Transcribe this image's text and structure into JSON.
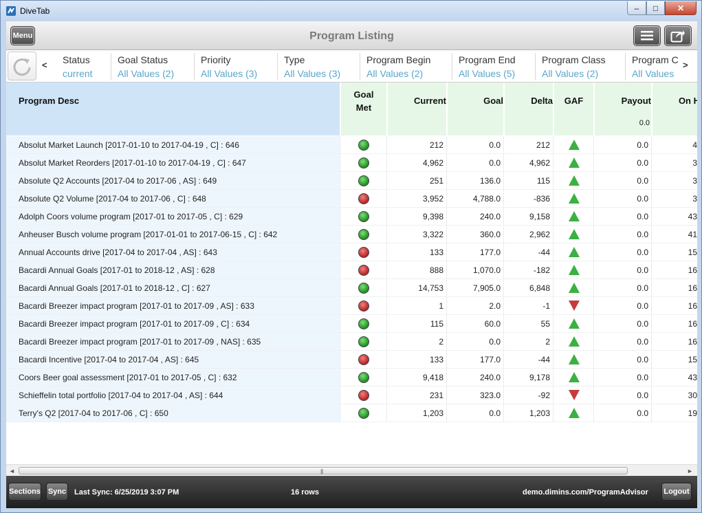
{
  "window": {
    "title": "DiveTab",
    "min": "–",
    "max": "□",
    "close": "✕"
  },
  "header": {
    "menu_label": "Menu",
    "page_title": "Program Listing"
  },
  "filters": [
    {
      "label": "Status",
      "value": "current"
    },
    {
      "label": "Goal Status",
      "value": "All Values (2)"
    },
    {
      "label": "Priority",
      "value": "All Values (3)"
    },
    {
      "label": "Type",
      "value": "All Values (3)"
    },
    {
      "label": "Program Begin",
      "value": "All Values (2)"
    },
    {
      "label": "Program End",
      "value": "All Values (5)"
    },
    {
      "label": "Program Class",
      "value": "All Values (2)"
    },
    {
      "label": "Program C",
      "value": "All Values"
    }
  ],
  "nav": {
    "left": "<",
    "right": ">"
  },
  "columns": {
    "desc": "Program Desc",
    "goal_met_1": "Goal",
    "goal_met_2": "Met",
    "current": "Current",
    "goal": "Goal",
    "delta": "Delta",
    "gaf": "GAF",
    "payout": "Payout",
    "payout_total": "0.0",
    "on_hand": "On H"
  },
  "status_colors": {
    "green": "#2a9a2a",
    "red": "#c03030",
    "up": "#3cb043",
    "down": "#c53c3c"
  },
  "rows": [
    {
      "desc": "Absolut Market Launch [2017-01-10 to 2017-04-19 , C] : 646",
      "met": "green",
      "current": "212",
      "goal": "0.0",
      "delta": "212",
      "gaf": "up",
      "payout": "0.0",
      "onh": "4"
    },
    {
      "desc": "Absolut Market Reorders [2017-01-10 to 2017-04-19 , C] : 647",
      "met": "green",
      "current": "4,962",
      "goal": "0.0",
      "delta": "4,962",
      "gaf": "up",
      "payout": "0.0",
      "onh": "3"
    },
    {
      "desc": "Absolute Q2 Accounts [2017-04 to 2017-06 , AS] : 649",
      "met": "green",
      "current": "251",
      "goal": "136.0",
      "delta": "115",
      "gaf": "up",
      "payout": "0.0",
      "onh": "3"
    },
    {
      "desc": "Absolute Q2 Volume [2017-04 to 2017-06 , C] : 648",
      "met": "red",
      "current": "3,952",
      "goal": "4,788.0",
      "delta": "-836",
      "gaf": "up",
      "payout": "0.0",
      "onh": "3"
    },
    {
      "desc": "Adolph Coors volume program [2017-01 to 2017-05 , C] : 629",
      "met": "green",
      "current": "9,398",
      "goal": "240.0",
      "delta": "9,158",
      "gaf": "up",
      "payout": "0.0",
      "onh": "43"
    },
    {
      "desc": "Anheuser Busch volume program [2017-01-01 to 2017-06-15 , C] : 642",
      "met": "green",
      "current": "3,322",
      "goal": "360.0",
      "delta": "2,962",
      "gaf": "up",
      "payout": "0.0",
      "onh": "41"
    },
    {
      "desc": "Annual Accounts drive [2017-04 to 2017-04 , AS] : 643",
      "met": "red",
      "current": "133",
      "goal": "177.0",
      "delta": "-44",
      "gaf": "up",
      "payout": "0.0",
      "onh": "15"
    },
    {
      "desc": "Bacardi Annual Goals [2017-01 to 2018-12 , AS] : 628",
      "met": "red",
      "current": "888",
      "goal": "1,070.0",
      "delta": "-182",
      "gaf": "up",
      "payout": "0.0",
      "onh": "16"
    },
    {
      "desc": "Bacardi Annual Goals [2017-01 to 2018-12 , C] : 627",
      "met": "green",
      "current": "14,753",
      "goal": "7,905.0",
      "delta": "6,848",
      "gaf": "up",
      "payout": "0.0",
      "onh": "16"
    },
    {
      "desc": "Bacardi Breezer impact program [2017-01 to 2017-09 , AS] : 633",
      "met": "red",
      "current": "1",
      "goal": "2.0",
      "delta": "-1",
      "gaf": "down",
      "payout": "0.0",
      "onh": "16"
    },
    {
      "desc": "Bacardi Breezer impact program [2017-01 to 2017-09 , C] : 634",
      "met": "green",
      "current": "115",
      "goal": "60.0",
      "delta": "55",
      "gaf": "up",
      "payout": "0.0",
      "onh": "16"
    },
    {
      "desc": "Bacardi Breezer impact program [2017-01 to 2017-09 , NAS] : 635",
      "met": "green",
      "current": "2",
      "goal": "0.0",
      "delta": "2",
      "gaf": "up",
      "payout": "0.0",
      "onh": "16"
    },
    {
      "desc": "Bacardi Incentive [2017-04 to 2017-04 , AS] : 645",
      "met": "red",
      "current": "133",
      "goal": "177.0",
      "delta": "-44",
      "gaf": "up",
      "payout": "0.0",
      "onh": "15"
    },
    {
      "desc": "Coors Beer goal assessment [2017-01 to 2017-05 , C] : 632",
      "met": "green",
      "current": "9,418",
      "goal": "240.0",
      "delta": "9,178",
      "gaf": "up",
      "payout": "0.0",
      "onh": "43"
    },
    {
      "desc": "Schieffelin total portfolio [2017-04 to 2017-04 , AS] : 644",
      "met": "red",
      "current": "231",
      "goal": "323.0",
      "delta": "-92",
      "gaf": "down",
      "payout": "0.0",
      "onh": "30"
    },
    {
      "desc": "Terry's Q2 [2017-04 to 2017-06 , C] : 650",
      "met": "green",
      "current": "1,203",
      "goal": "0.0",
      "delta": "1,203",
      "gaf": "up",
      "payout": "0.0",
      "onh": "19"
    }
  ],
  "scroll": {
    "left": "◄",
    "right": "►",
    "grip": "|||"
  },
  "footer": {
    "sections_label": "Sections",
    "sync_label": "Sync",
    "last_sync": "Last Sync: 6/25/2019 3:07 PM",
    "row_count": "16 rows",
    "server": "demo.dimins.com/ProgramAdvisor",
    "logout_label": "Logout"
  }
}
